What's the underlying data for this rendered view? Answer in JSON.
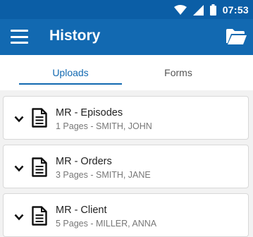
{
  "status_bar": {
    "time": "07:53",
    "icons": [
      "wifi-icon",
      "signal-icon",
      "battery-icon"
    ]
  },
  "app_bar": {
    "title": "History",
    "menu_icon": "hamburger-menu-icon",
    "action_icon": "open-folder-icon"
  },
  "tabs": [
    {
      "label": "Uploads",
      "active": true
    },
    {
      "label": "Forms",
      "active": false
    }
  ],
  "history_items": [
    {
      "title": "MR - Episodes",
      "subtitle": "1 Pages - SMITH, JOHN"
    },
    {
      "title": "MR - Orders",
      "subtitle": "3 Pages - SMITH, JANE"
    },
    {
      "title": "MR - Client",
      "subtitle": "5 Pages - MILLER, ANNA"
    }
  ],
  "colors": {
    "primary": "#1269b1",
    "status_bar": "#0b5ea6",
    "background": "#f2f2f2",
    "inactive_tab": "#555555",
    "subtitle": "#777777"
  }
}
